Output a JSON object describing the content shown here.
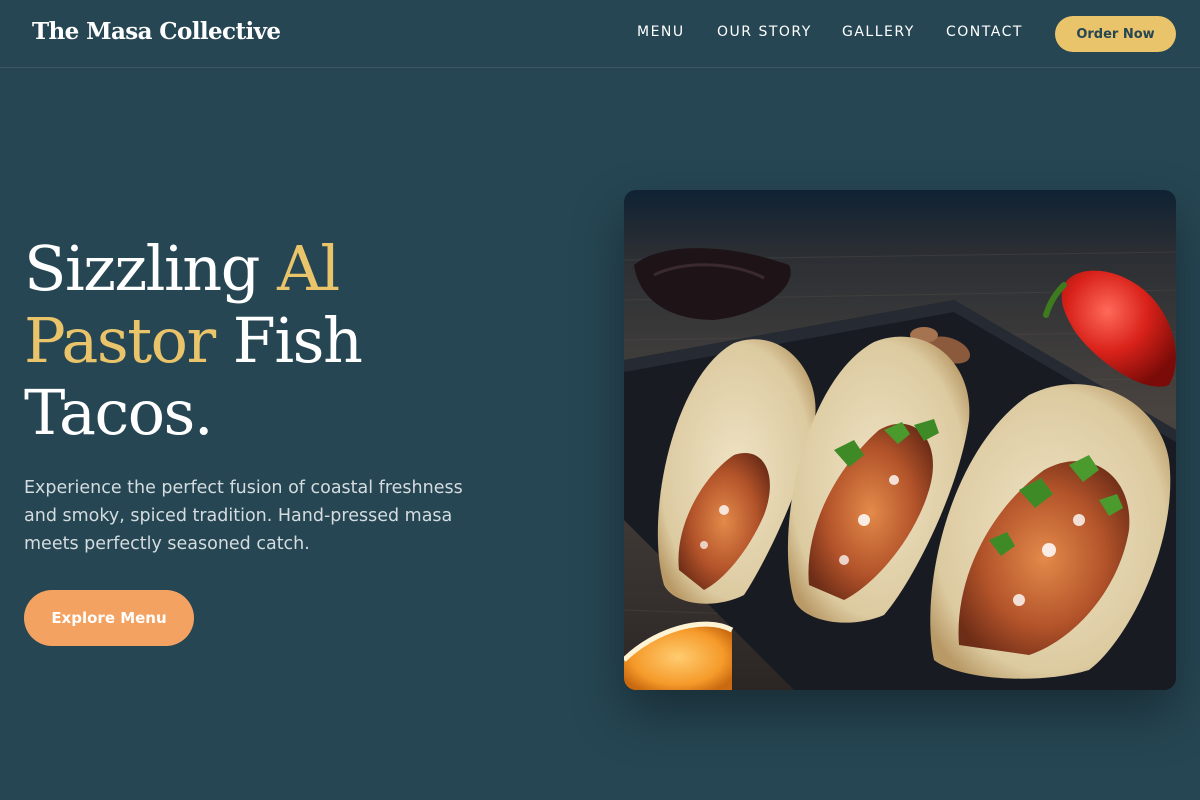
{
  "header": {
    "logo": "The Masa Collective",
    "nav": [
      "MENU",
      "OUR STORY",
      "GALLERY",
      "CONTACT"
    ],
    "cta": "Order Now"
  },
  "hero": {
    "title": {
      "part1": "Sizzling ",
      "accent1": "Al",
      "accent2": "Pastor",
      "part2": " Fish",
      "part3": "Tacos."
    },
    "description": "Experience the perfect fusion of coastal freshness and smoky, spiced tradition. Hand-pressed masa meets perfectly seasoned catch.",
    "button": "Explore Menu"
  },
  "colors": {
    "background": "#264653",
    "accent": "#e9c46a",
    "button": "#f4a261",
    "text": "#ffffff"
  },
  "image": {
    "subject": "three al pastor fish tacos on a slate board"
  }
}
